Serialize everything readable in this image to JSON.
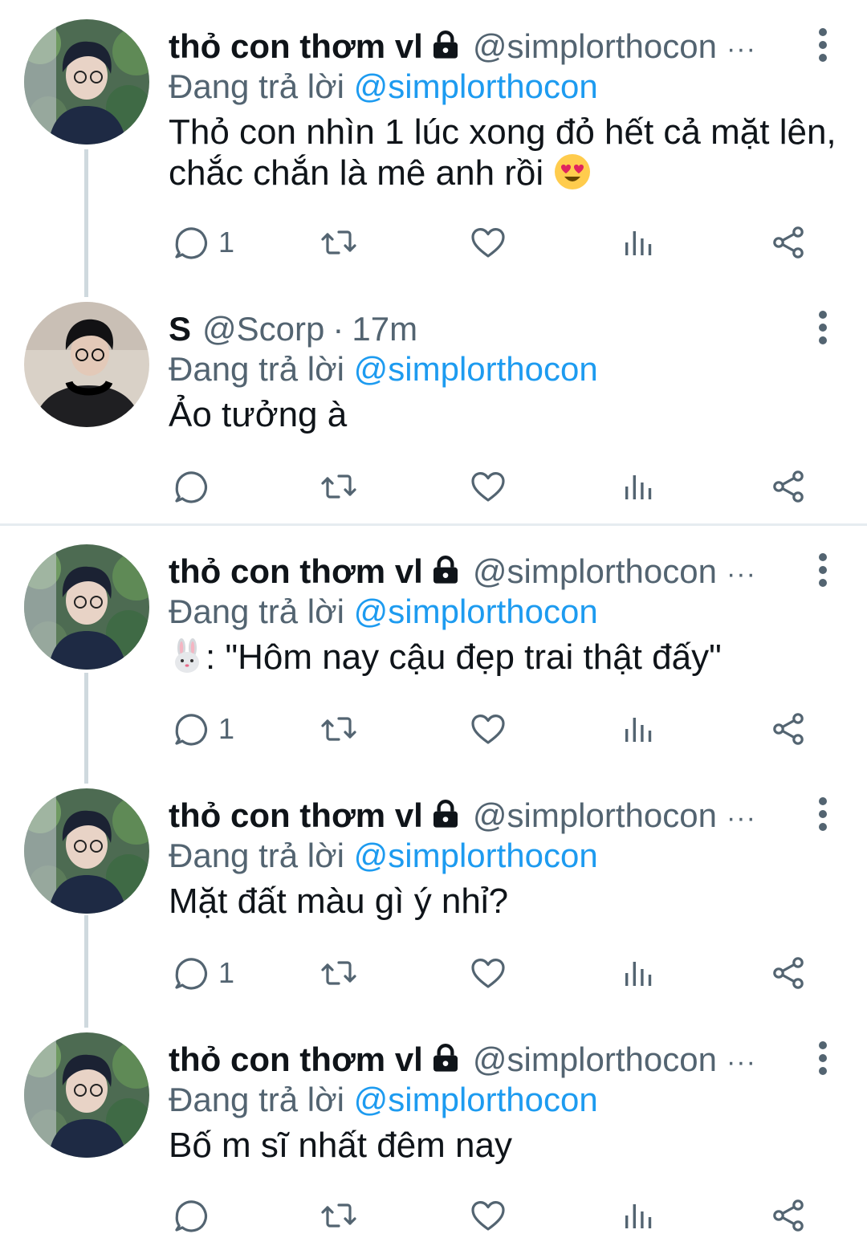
{
  "tweets": [
    {
      "name": "thỏ con thơm vl",
      "handle": "@simplorthocon",
      "time": "",
      "locked": true,
      "reply_prefix": "Đang trả lời",
      "reply_to": "@simplorthocon",
      "text_line1": "Thỏ con nhìn 1 lúc xong đỏ hết cả mặt lên,",
      "text_line2": "chắc chắn là mê anh rồi",
      "emoji": "heart-eyes",
      "reply_count": "1",
      "avatar": "avatar-boy-glasses-garden"
    },
    {
      "name": "S",
      "handle": "@Scorp",
      "time": "17m",
      "locked": false,
      "reply_prefix": "Đang trả lời",
      "reply_to": "@simplorthocon",
      "text_line1": "Ảo tưởng à",
      "text_line2": "",
      "reply_count": "",
      "avatar": "avatar-boy-headphones"
    },
    {
      "name": "thỏ con thơm vl",
      "handle": "@simplorthocon",
      "time": "",
      "locked": true,
      "reply_prefix": "Đang trả lời",
      "reply_to": "@simplorthocon",
      "text_line1": ": \"Hôm nay cậu đẹp trai thật đấy\"",
      "text_line2": "",
      "emoji": "rabbit-face",
      "reply_count": "1",
      "avatar": "avatar-boy-glasses-garden"
    },
    {
      "name": "thỏ con thơm vl",
      "handle": "@simplorthocon",
      "time": "",
      "locked": true,
      "reply_prefix": "Đang trả lời",
      "reply_to": "@simplorthocon",
      "text_line1": "Mặt đất màu gì ý nhỉ?",
      "text_line2": "",
      "reply_count": "1",
      "avatar": "avatar-boy-glasses-garden"
    },
    {
      "name": "thỏ con thơm vl",
      "handle": "@simplorthocon",
      "time": "",
      "locked": true,
      "reply_prefix": "Đang trả lời",
      "reply_to": "@simplorthocon",
      "text_line1": "Bố m sĩ nhất đêm nay",
      "text_line2": "",
      "reply_count": "",
      "avatar": "avatar-boy-glasses-garden"
    }
  ],
  "icons": {
    "reply": "reply-icon",
    "retweet": "retweet-icon",
    "like": "like-icon",
    "views": "views-icon",
    "share": "share-icon",
    "more": "more-vertical-icon",
    "lock": "lock-icon"
  },
  "colors": {
    "text": "#0f1419",
    "secondary": "#536471",
    "link": "#1d9bf0",
    "thread_line": "#cfd9de"
  }
}
